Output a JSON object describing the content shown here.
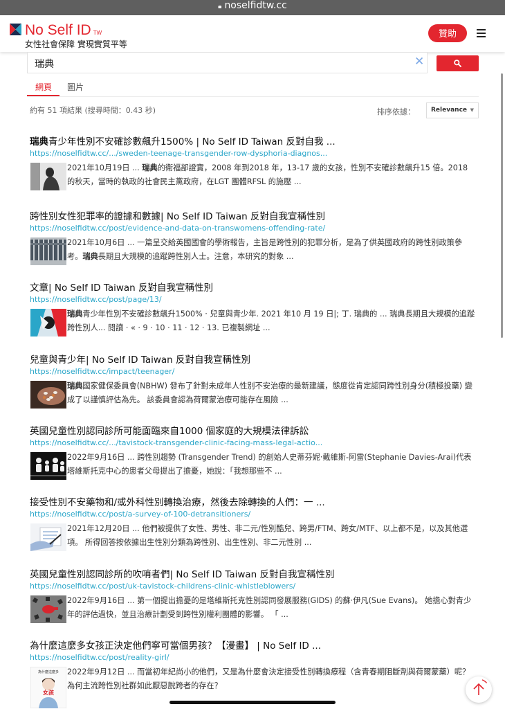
{
  "browser": {
    "url": "noselfidtw.cc"
  },
  "site": {
    "title": "No Self ID",
    "tw": "TW",
    "subtitle": "女性社會保障 實現實質平等",
    "donate": "贊助",
    "brand_color": "#e3262f"
  },
  "search": {
    "query": "瑞典"
  },
  "tabs": [
    {
      "label": "網頁"
    },
    {
      "label": "圖片"
    }
  ],
  "meta": {
    "count": "約有 51 項結果 (搜尋時間：0.43 秒)",
    "sort_label": "排序依據：",
    "sort_value": "Relevance"
  },
  "results": [
    {
      "title_bold": "瑞典",
      "title_rest": "青少年性別不安確診數飆升1500% | No Self ID Taiwan 反對自我 ...",
      "url": "https://noselfidtw.cc/.../sweden-teenage-transgender-row-dysphoria-diagnos...",
      "snip_pre": "2021年10月19日 ... ",
      "snip_bold": "瑞典",
      "snip_rest": "的衛福部證實，2008 年到2018 年，13-17 歲的女孩，性別不安確診數飆升15 倍。2018 的秋天，當時的執政的社會民主黨政府，在LGT 團體RFSL 的施壓 ...",
      "thumb": "person-sitting-photo"
    },
    {
      "title_bold": "",
      "title_rest": "跨性別女性犯罪率的證據和數據| No Self ID Taiwan 反對自我宣稱性別",
      "url": "https://noselfidtw.cc/post/evidence-and-data-on-transwomens-offending-rate/",
      "snip_pre": "2021年10月6日 ... 一篇呈交給英國國會的學術報告，主旨是跨性別的犯罪分析，是為了供英國政府的跨性別政策參考。",
      "snip_bold": "瑞典",
      "snip_rest": "長期且大規模的追蹤跨性別人士。注意，本研究的對象 ...",
      "thumb": "prison-bars-photo"
    },
    {
      "title_bold": "",
      "title_rest": "文章| No Self ID Taiwan 反對自我宣稱性別",
      "url": "https://noselfidtw.cc/post/page/13/",
      "snip_pre": "",
      "snip_bold": "瑞典",
      "snip_rest": "青少年性別不安確診數飆升1500% · 兒童與青少年. 2021 年10 月 19 日|; 丁. 瑞典的 ... 瑞典長期且大規模的追蹤跨性別人... 閱讀 · « · 9 · 10 · 11 · 12 · 13. 已複製網址 ...",
      "thumb": "red-blue-graphic"
    },
    {
      "title_bold": "",
      "title_rest": "兒童與青少年| No Self ID Taiwan 反對自我宣稱性別",
      "url": "https://noselfidtw.cc/impact/teenager/",
      "snip_pre": "",
      "snip_bold": "瑞典",
      "snip_rest": "國家健保委員會(NBHW) 發布了針對未成年人性別不安治療的最新建議，態度從肯定認同跨性別身分(積極投藥) 變成了以謹慎評估為先。 該委員會認為荷爾蒙治療可能存在風險 ...",
      "thumb": "pills-hand-photo"
    },
    {
      "title_bold": "",
      "title_rest": "英國兒童性別認同診所可能面臨來自1000 個家庭的大規模法律訴訟",
      "url": "https://noselfidtw.cc/.../tavistock-transgender-clinic-facing-mass-legal-actio...",
      "snip_pre": "2022年9月16日 ... 跨性別趨勢 (Transgender Trend) 的創始人史蒂芬妮·戴維斯-阿雷(Stephanie Davies-Arai)代表塔維斯托克中心的患者父母提出了擔憂，她說：「我想那些不 ...",
      "snip_bold": "",
      "snip_rest": "",
      "thumb": "family-icons"
    },
    {
      "title_bold": "",
      "title_rest": "接受性別不安藥物和/或外科性別轉換治療，然後去除轉換的人們：一 ...",
      "url": "https://noselfidtw.cc/post/a-survey-of-100-detransitioners/",
      "snip_pre": "2021年12月20日 ... 他們被提供了女性、男性、非二元/性別酷兒、跨男/FTM、跨女/MTF、以上都不是，以及其他選項。 所得回答按依據出生性別分類為跨性別、出生性別、非二元性別 ...",
      "snip_bold": "",
      "snip_rest": "",
      "thumb": "survey-hand-photo"
    },
    {
      "title_bold": "",
      "title_rest": "英國兒童性別認同診所的吹哨者們| No Self ID Taiwan 反對自我宣稱性別",
      "url": "https://noselfidtw.cc/post/uk-tavistock-childrens-clinic-whistleblowers/",
      "snip_pre": "2022年9月16日 ... 第一個提出擔憂的是塔維斯托克性別認同發展服務(GIDS) 的蘇·伊凡(Sue Evans)。 她擔心對青少年的評估過快，並且治療計劃受到跨性別權利團體的影響。 「 ...",
      "snip_bold": "",
      "snip_rest": "",
      "thumb": "whistle-photo"
    },
    {
      "title_bold": "",
      "title_rest": "為什麼這麼多女孩正決定他們寧可當個男孩？【漫畫】 | No Self ID ...",
      "url": "https://noselfidtw.cc/post/reality-girl/",
      "snip_pre": "2022年9月12日 ... 而當初年紀尚小的他們，又是為什麼會決定接受性別轉換療程（含青春期阻斷劑與荷爾蒙藥）呢？為何主流跨性別社群如此厭惡脫跨者的存在？",
      "snip_bold": "",
      "snip_rest": "",
      "thumb": "comic-cover",
      "thumb_text_top": "為什麼這麼多",
      "thumb_text_mid": "女孩"
    }
  ]
}
